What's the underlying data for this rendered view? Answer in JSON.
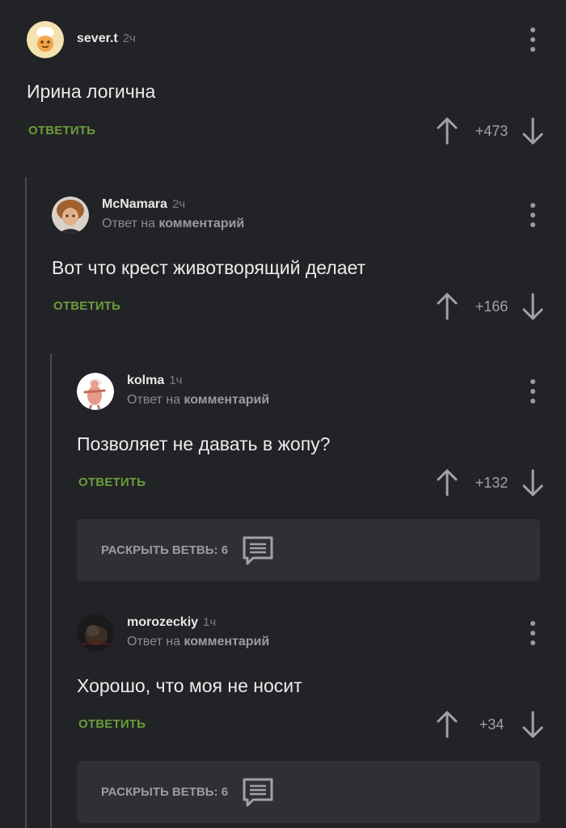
{
  "comments": [
    {
      "username": "sever.t",
      "time": "2ч",
      "text": "Ирина логична",
      "reply_label": "ОТВЕТИТЬ",
      "score": "+473",
      "avatar_icon": "emoji-avatar-icon"
    },
    {
      "username": "McNamara",
      "time": "2ч",
      "reply_to_prefix": "Ответ на",
      "reply_to_target": "комментарий",
      "text": "Вот что крест животворящий делает",
      "reply_label": "ОТВЕТИТЬ",
      "score": "+166",
      "avatar_icon": "person-avatar-icon"
    },
    {
      "username": "kolma",
      "time": "1ч",
      "reply_to_prefix": "Ответ на",
      "reply_to_target": "комментарий",
      "text": "Позволяет не давать в жопу?",
      "reply_label": "ОТВЕТИТЬ",
      "score": "+132",
      "avatar_icon": "cartoon-avatar-icon"
    },
    {
      "username": "morozeckiy",
      "time": "1ч",
      "reply_to_prefix": "Ответ на",
      "reply_to_target": "комментарий",
      "text": "Хорошо, что моя не носит",
      "reply_label": "ОТВЕТИТЬ",
      "score": "+34",
      "avatar_icon": "dark-avatar-icon"
    }
  ],
  "expand_branches": [
    {
      "label": "РАСКРЫТЬ ВЕТВЬ: 6",
      "icon": "comment-bubble-icon"
    },
    {
      "label": "РАСКРЫТЬ ВЕТВЬ: 6",
      "icon": "comment-bubble-icon"
    }
  ],
  "colors": {
    "background": "#222326",
    "reply_green": "#6a9c3c",
    "muted": "#8a8c90",
    "expand_bg": "#2f3034"
  }
}
